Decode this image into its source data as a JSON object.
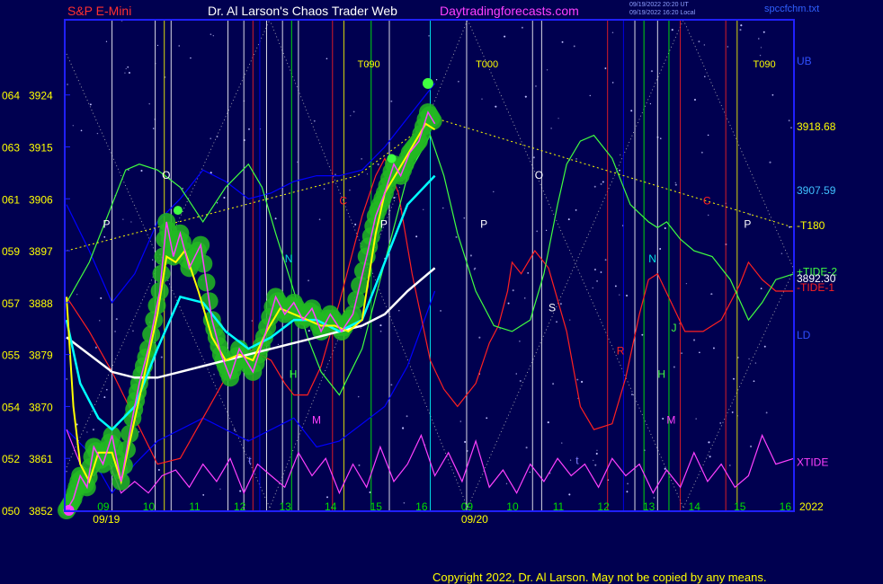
{
  "header": {
    "left_title": "S&P E-Mini",
    "center_title": "Dr. Al Larson's Chaos Trader Web",
    "site": "Daytradingforecasts.com",
    "meta_line_1": "09/19/2022 20:20 UT",
    "meta_line_2": "09/19/2022 16:20 Local",
    "file_name": "spccfchm.txt"
  },
  "footer": {
    "copyright": "Copyright 2022, Dr. Al Larson. May not be copied by any means."
  },
  "colors": {
    "background": "#000050",
    "frame": "#2020ff",
    "price_text": "#ffff00",
    "time_text": "#00e000",
    "date_text": "#ffff00",
    "header_left": "#ff3030",
    "header_center": "#ffffff",
    "header_site": "#ff40ff",
    "tide1": "#ff2020",
    "tide2": "#40ff40",
    "xtide": "#ff40ff",
    "band_upper": "#0000ff",
    "mid_band": "#00ffff",
    "ma_white": "#ffffff",
    "fast_avg": "#ffff00",
    "price_blob": "#22b822",
    "ub_label": "#3050ff"
  },
  "chart_data": {
    "type": "line",
    "title": "S&P E-Mini",
    "y_ticks": [
      {
        "code": "050",
        "price": "3852"
      },
      {
        "code": "052",
        "price": "3861"
      },
      {
        "code": "054",
        "price": "3870"
      },
      {
        "code": "055",
        "price": "3879"
      },
      {
        "code": "057",
        "price": "3888"
      },
      {
        "code": "059",
        "price": "3897"
      },
      {
        "code": "061",
        "price": "3906"
      },
      {
        "code": "063",
        "price": "3915"
      },
      {
        "code": "064",
        "price": "3924"
      }
    ],
    "ylim": [
      3852,
      3928
    ],
    "x_tick_labels": [
      "09",
      "10",
      "11",
      "12",
      "13",
      "14",
      "15",
      "16",
      "09",
      "10",
      "11",
      "12",
      "13",
      "14",
      "15",
      "16"
    ],
    "x_tick_positions": [
      9,
      10,
      11,
      12,
      13,
      14,
      15,
      16,
      17,
      18,
      19,
      20,
      21,
      22,
      23,
      24
    ],
    "dates": [
      {
        "label": "09/19",
        "x": 8.5
      },
      {
        "label": "09/20",
        "x": 16.6
      }
    ],
    "year": "2022",
    "xlim": [
      8.0,
      24.0
    ],
    "right_labels": [
      {
        "text": "UB",
        "y": 3930
      },
      {
        "text": "3918.68",
        "y": 3918.68
      },
      {
        "text": "3907.59",
        "y": 3907.59
      },
      {
        "text": "-T180",
        "y": 3901.5
      },
      {
        "text": "+TIDE-2",
        "y": 3893.5
      },
      {
        "text": "3892.30",
        "y": 3892.3
      },
      {
        "text": "-TIDE-1",
        "y": 3890.8
      },
      {
        "text": "LD",
        "y": 3882.5
      },
      {
        "text": "XTIDE",
        "y": 3860.5
      }
    ],
    "top_markers": [
      {
        "text": "T090",
        "x": 14.4
      },
      {
        "text": "T000",
        "x": 17.0
      },
      {
        "text": "T090",
        "x": 23.1
      }
    ],
    "letter_markers": [
      {
        "text": "P",
        "x": 8.8,
        "y": 3901,
        "color": "#ffffff"
      },
      {
        "text": "O",
        "x": 10.1,
        "y": 3909.5,
        "color": "#ffffff"
      },
      {
        "text": "N",
        "x": 12.8,
        "y": 3895,
        "color": "#00e0e0"
      },
      {
        "text": "C",
        "x": 14.0,
        "y": 3905,
        "color": "#ff2020"
      },
      {
        "text": "P",
        "x": 14.9,
        "y": 3901,
        "color": "#ffffff"
      },
      {
        "text": "H",
        "x": 12.9,
        "y": 3875,
        "color": "#40ff40"
      },
      {
        "text": "M",
        "x": 13.4,
        "y": 3867,
        "color": "#ff40ff"
      },
      {
        "text": "t",
        "x": 12.0,
        "y": 3860,
        "color": "#8080ff"
      },
      {
        "text": "P",
        "x": 17.1,
        "y": 3901,
        "color": "#ffffff"
      },
      {
        "text": "O",
        "x": 18.3,
        "y": 3909.5,
        "color": "#ffffff"
      },
      {
        "text": "S",
        "x": 18.6,
        "y": 3886.5,
        "color": "#ffffff"
      },
      {
        "text": "t",
        "x": 19.2,
        "y": 3860,
        "color": "#8080ff"
      },
      {
        "text": "R",
        "x": 20.1,
        "y": 3879,
        "color": "#ff2020"
      },
      {
        "text": "N",
        "x": 20.8,
        "y": 3895,
        "color": "#00e0e0"
      },
      {
        "text": "H",
        "x": 21.0,
        "y": 3875,
        "color": "#40ff40"
      },
      {
        "text": "J",
        "x": 21.3,
        "y": 3883,
        "color": "#40ff40"
      },
      {
        "text": "M",
        "x": 21.2,
        "y": 3867,
        "color": "#ff40ff"
      },
      {
        "text": "C",
        "x": 22.0,
        "y": 3905,
        "color": "#ff2020"
      },
      {
        "text": "P",
        "x": 22.9,
        "y": 3901,
        "color": "#ffffff"
      }
    ],
    "series": [
      {
        "name": "price",
        "x": [
          8.0,
          8.15,
          8.3,
          8.45,
          8.6,
          8.8,
          9.0,
          9.2,
          9.45,
          9.6,
          9.8,
          10.05,
          10.2,
          10.35,
          10.5,
          10.7,
          10.95,
          11.2,
          11.4,
          11.6,
          11.8,
          12.1,
          12.35,
          12.6,
          12.8,
          13.0,
          13.2,
          13.4,
          13.6,
          13.8,
          14.05,
          14.3,
          14.6,
          14.8,
          15.0,
          15.2,
          15.35,
          15.55,
          15.75,
          15.95,
          16.1
        ],
        "values": [
          3852,
          3854,
          3858,
          3856,
          3863,
          3860,
          3865,
          3857,
          3868,
          3874,
          3880,
          3890,
          3902,
          3896,
          3900,
          3894,
          3898,
          3885,
          3879,
          3875,
          3880,
          3876,
          3882,
          3889,
          3886,
          3888,
          3885,
          3887,
          3883,
          3886,
          3883,
          3886,
          3896,
          3903,
          3907,
          3912,
          3910,
          3914,
          3916,
          3921,
          3919
        ]
      },
      {
        "name": "fast_avg",
        "x": [
          8.0,
          8.15,
          8.3,
          8.5,
          8.7,
          9.0,
          9.2,
          9.45,
          9.7,
          10.0,
          10.2,
          10.4,
          10.6,
          10.9,
          11.2,
          11.5,
          11.8,
          12.1,
          12.4,
          12.7,
          13.0,
          13.3,
          13.6,
          13.9,
          14.2,
          14.5,
          14.8,
          15.0,
          15.3,
          15.6,
          15.9,
          16.1
        ],
        "values": [
          3889,
          3870,
          3860,
          3857,
          3862,
          3862,
          3857,
          3866,
          3875,
          3886,
          3896,
          3895,
          3897,
          3890,
          3882,
          3878,
          3879,
          3878,
          3883,
          3887,
          3886,
          3885,
          3884,
          3884,
          3883,
          3885,
          3900,
          3907,
          3911,
          3915,
          3919,
          3918
        ]
      },
      {
        "name": "cyan_avg",
        "x": [
          8.0,
          8.3,
          8.7,
          9.0,
          9.5,
          10.0,
          10.5,
          11.0,
          11.5,
          12.0,
          12.5,
          13.0,
          13.5,
          14.0,
          14.5,
          15.0,
          15.5,
          16.1
        ],
        "values": [
          3885,
          3874,
          3868,
          3866,
          3870,
          3880,
          3889,
          3888,
          3883,
          3880,
          3882,
          3885,
          3885,
          3883,
          3885,
          3895,
          3905,
          3910
        ]
      },
      {
        "name": "white_ma",
        "x": [
          8.0,
          8.5,
          9.0,
          9.5,
          10.0,
          10.5,
          11.0,
          11.5,
          12.0,
          12.5,
          13.0,
          13.5,
          14.0,
          14.5,
          15.0,
          15.5,
          16.1
        ],
        "values": [
          3882,
          3879,
          3876,
          3875,
          3875,
          3876,
          3877,
          3878,
          3879,
          3880,
          3881,
          3882,
          3883,
          3884,
          3886,
          3890,
          3894
        ]
      },
      {
        "name": "TIDE-2",
        "x": [
          8.0,
          8.5,
          9.0,
          9.3,
          9.6,
          10.0,
          10.5,
          11.0,
          11.5,
          12.0,
          12.3,
          12.6,
          13.0,
          13.3,
          13.6,
          14.0,
          14.5,
          15.0,
          15.5,
          16.0,
          16.3,
          16.6,
          17.0,
          17.4,
          17.8,
          18.2,
          18.5,
          18.8,
          19.0,
          19.3,
          19.6,
          20.0,
          20.4,
          20.8,
          21.0,
          21.2,
          21.5,
          21.8,
          22.2,
          22.6,
          23.0,
          23.3,
          23.6,
          24.0
        ],
        "values": [
          3888,
          3895,
          3905,
          3911,
          3912,
          3911,
          3908,
          3902,
          3908,
          3912,
          3908,
          3900,
          3890,
          3882,
          3876,
          3872,
          3880,
          3895,
          3910,
          3917,
          3910,
          3900,
          3890,
          3884,
          3883,
          3885,
          3893,
          3905,
          3912,
          3916,
          3917,
          3913,
          3905,
          3902,
          3901,
          3902,
          3899,
          3897,
          3896,
          3892,
          3885,
          3888,
          3892,
          3893
        ]
      },
      {
        "name": "TIDE-1",
        "x": [
          8.0,
          8.5,
          9.0,
          9.5,
          10.0,
          10.5,
          11.0,
          11.5,
          12.0,
          12.5,
          12.8,
          13.0,
          13.3,
          13.6,
          14.0,
          14.5,
          14.8,
          15.0,
          15.3,
          15.6,
          16.0,
          16.3,
          16.6,
          17.0,
          17.3,
          17.5,
          17.7,
          17.8,
          18.0,
          18.3,
          18.6,
          19.0,
          19.3,
          19.6,
          20.0,
          20.3,
          20.6,
          20.8,
          21.0,
          21.3,
          21.6,
          22.0,
          22.4,
          22.8,
          23.0,
          23.3,
          23.6,
          24.0
        ],
        "values": [
          3889,
          3883,
          3876,
          3868,
          3860,
          3861,
          3868,
          3875,
          3880,
          3878,
          3874,
          3872,
          3872,
          3877,
          3888,
          3903,
          3910,
          3913,
          3907,
          3893,
          3878,
          3873,
          3870,
          3874,
          3881,
          3884,
          3890,
          3895,
          3893,
          3897,
          3894,
          3883,
          3870,
          3866,
          3867,
          3875,
          3886,
          3892,
          3893,
          3888,
          3883,
          3883,
          3885,
          3891,
          3895,
          3892,
          3890,
          3890
        ]
      },
      {
        "name": "XTIDE",
        "x": [
          8.0,
          8.3,
          8.6,
          8.9,
          9.2,
          9.5,
          9.8,
          10.1,
          10.4,
          10.7,
          11.0,
          11.3,
          11.6,
          11.9,
          12.2,
          12.5,
          12.8,
          13.1,
          13.4,
          13.7,
          14.0,
          14.3,
          14.6,
          14.9,
          15.2,
          15.5,
          15.8,
          16.1,
          16.4,
          16.7,
          17.0,
          17.3,
          17.6,
          17.9,
          18.2,
          18.5,
          18.8,
          19.1,
          19.4,
          19.7,
          20.0,
          20.3,
          20.6,
          20.9,
          21.2,
          21.5,
          21.8,
          22.1,
          22.4,
          22.7,
          23.0,
          23.3,
          23.6,
          24.0
        ],
        "values": [
          3866,
          3860,
          3858,
          3861,
          3855,
          3857,
          3855,
          3858,
          3859,
          3856,
          3860,
          3857,
          3861,
          3855,
          3860,
          3858,
          3856,
          3862,
          3858,
          3861,
          3855,
          3860,
          3856,
          3863,
          3857,
          3860,
          3865,
          3858,
          3862,
          3857,
          3864,
          3856,
          3859,
          3855,
          3860,
          3857,
          3861,
          3858,
          3860,
          3856,
          3861,
          3858,
          3860,
          3855,
          3859,
          3856,
          3862,
          3857,
          3860,
          3856,
          3858,
          3865,
          3860,
          3861
        ]
      },
      {
        "name": "band_upper",
        "x": [
          8.0,
          8.5,
          9.0,
          9.5,
          10.0,
          10.5,
          11.0,
          11.5,
          12.0,
          12.5,
          13.0,
          13.5,
          14.0,
          14.5,
          15.0,
          15.5,
          16.1
        ],
        "values": [
          3905,
          3897,
          3888,
          3893,
          3902,
          3906,
          3911,
          3909,
          3906,
          3907,
          3909,
          3910,
          3910,
          3911,
          3915,
          3920,
          3926
        ]
      },
      {
        "name": "band_lower",
        "x": [
          8.0,
          8.5,
          9.0,
          9.5,
          10.0,
          10.5,
          11.0,
          11.5,
          12.0,
          12.5,
          13.0,
          13.5,
          14.0,
          14.5,
          15.0,
          15.5,
          16.1
        ],
        "values": [
          3866,
          3862,
          3855,
          3860,
          3864,
          3866,
          3868,
          3866,
          3864,
          3866,
          3868,
          3863,
          3864,
          3867,
          3870,
          3877,
          3890
        ]
      },
      {
        "name": "T180",
        "x": [
          8.0,
          14.4,
          16.1,
          24.0
        ],
        "values": [
          3897,
          3910,
          3920,
          3901
        ]
      }
    ]
  }
}
